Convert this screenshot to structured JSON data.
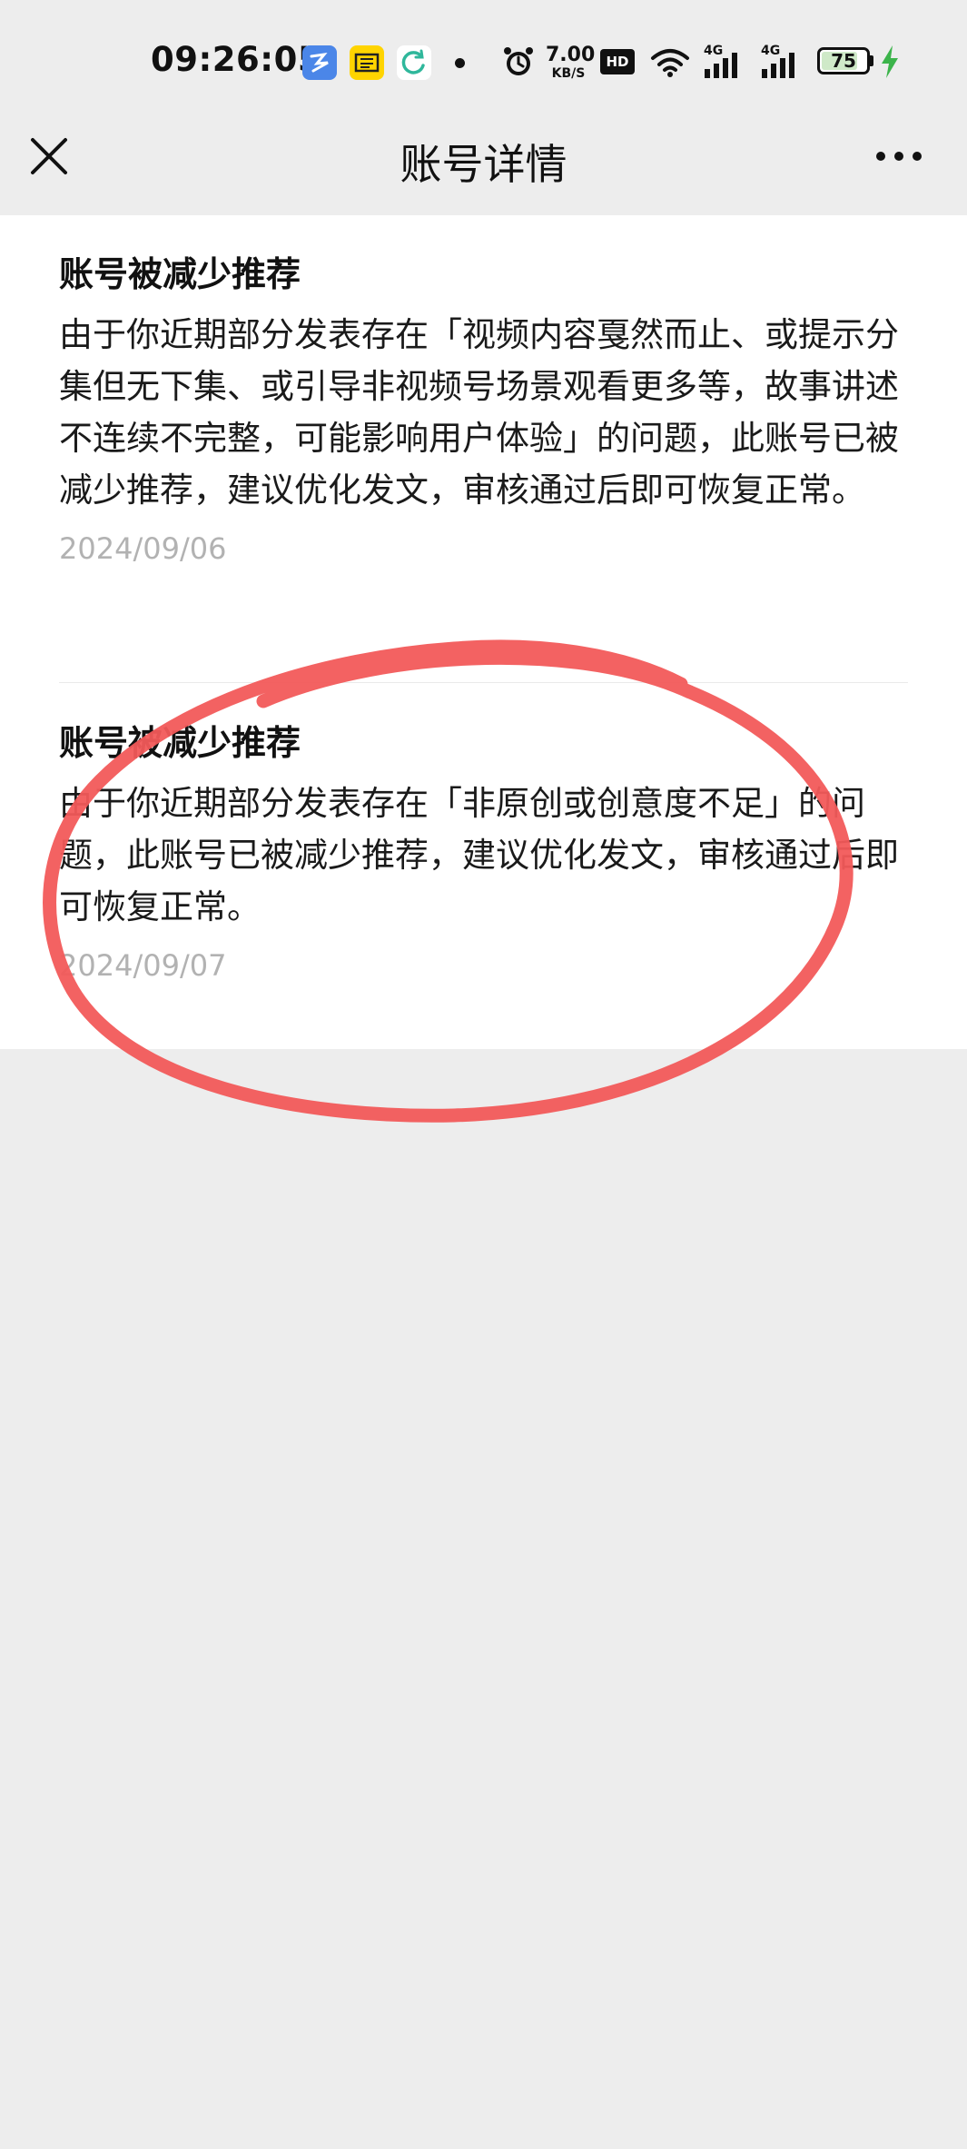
{
  "status_bar": {
    "time": "09:26:05",
    "net_speed_value": "7.00",
    "net_speed_unit": "KB/S",
    "hd_label": "HD",
    "network_1": "4G",
    "network_2": "4G",
    "battery_level": "75"
  },
  "nav": {
    "title": "账号详情"
  },
  "notices": [
    {
      "title": "账号被减少推荐",
      "body": "由于你近期部分发表存在「视频内容戛然而止、或提示分集但无下集、或引导非视频号场景观看更多等，故事讲述不连续不完整，可能影响用户体验」的问题，此账号已被减少推荐，建议优化发文，审核通过后即可恢复正常。",
      "date": "2024/09/06"
    },
    {
      "title": "账号被减少推荐",
      "body": "由于你近期部分发表存在「非原创或创意度不足」的问题，此账号已被减少推荐，建议优化发文，审核通过后即可恢复正常。",
      "date": "2024/09/07"
    }
  ],
  "colors": {
    "page_background": "#ededed",
    "card_background": "#ffffff",
    "date_text": "#b2b2b2",
    "annotation_red": "#f25a5a",
    "charging_green": "#3cb44b"
  }
}
